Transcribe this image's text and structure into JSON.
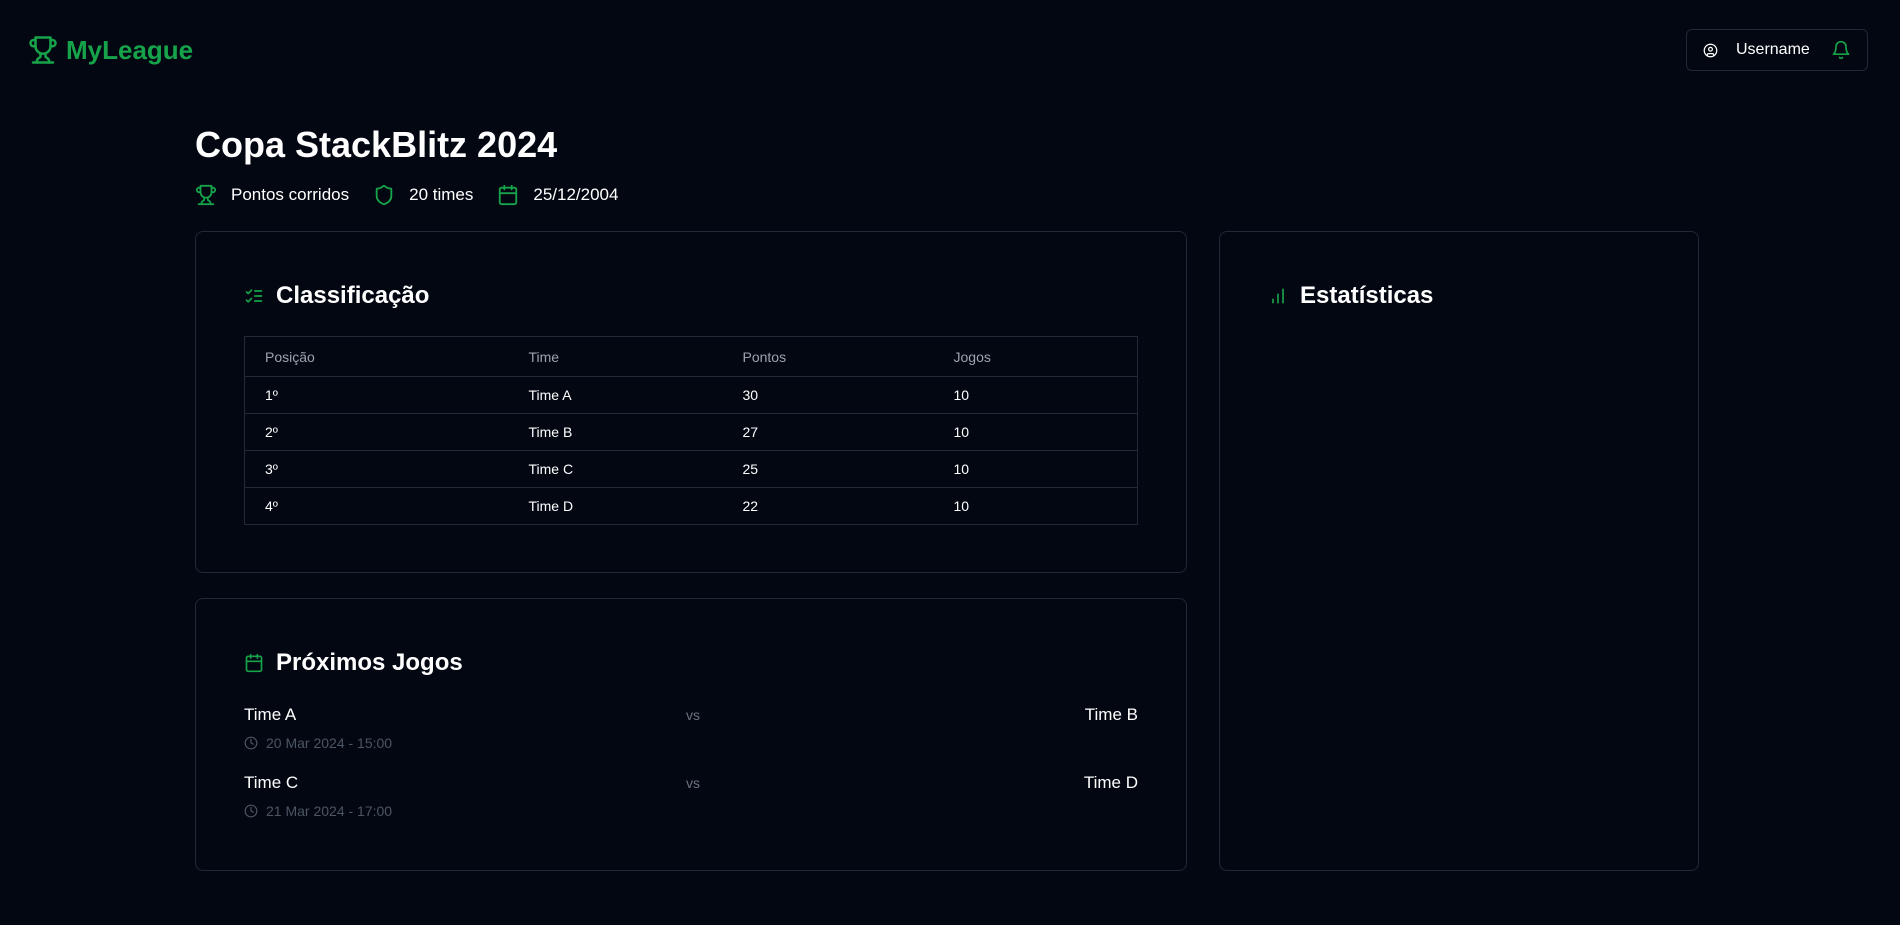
{
  "app": {
    "name": "MyLeague"
  },
  "user": {
    "name": "Username"
  },
  "league": {
    "title": "Copa StackBlitz 2024",
    "format": "Pontos corridos",
    "teams": "20 times",
    "date": "25/12/2004"
  },
  "standings": {
    "title": "Classificação",
    "columns": [
      "Posição",
      "Time",
      "Pontos",
      "Jogos"
    ],
    "rows": [
      [
        "1º",
        "Time A",
        "30",
        "10"
      ],
      [
        "2º",
        "Time B",
        "27",
        "10"
      ],
      [
        "3º",
        "Time C",
        "25",
        "10"
      ],
      [
        "4º",
        "Time D",
        "22",
        "10"
      ]
    ]
  },
  "upcoming": {
    "title": "Próximos Jogos",
    "vs_label": "vs",
    "matches": [
      {
        "home": "Time A",
        "away": "Time B",
        "when": "20 Mar 2024 - 15:00"
      },
      {
        "home": "Time C",
        "away": "Time D",
        "when": "21 Mar 2024 - 17:00"
      }
    ]
  },
  "stats": {
    "title": "Estatísticas"
  },
  "colors": {
    "accent": "#16a34a",
    "background": "#030712",
    "border": "#1f2937"
  },
  "icons": {
    "logo": "trophy-icon",
    "user": "user-circle-icon",
    "notifications": "bell-icon",
    "format": "trophy-icon",
    "teams": "shield-icon",
    "date": "calendar-icon",
    "standings": "list-checks-icon",
    "upcoming": "calendar-icon",
    "stats": "bar-chart-icon",
    "match_time": "clock-icon"
  }
}
